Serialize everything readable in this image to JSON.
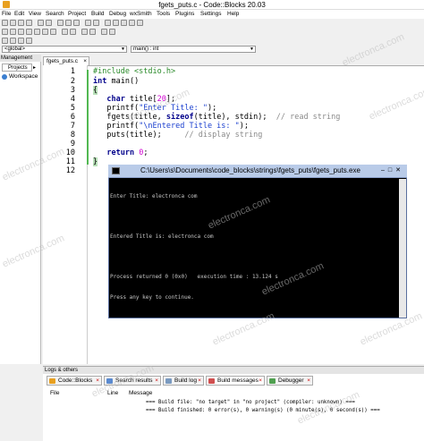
{
  "window": {
    "title": "fgets_puts.c - Code::Blocks 20.03"
  },
  "menu": [
    "File",
    "Edit",
    "View",
    "Search",
    "Project",
    "Build",
    "Debug",
    "wxSmith",
    "Tools",
    "Plugins",
    "Settings",
    "Help"
  ],
  "scope_combo": {
    "value": "<global>"
  },
  "function_combo": {
    "value": "main() : int"
  },
  "management": {
    "header": "Management",
    "tab": "Projects",
    "workspace": "Workspace"
  },
  "editor": {
    "tab_label": "fgets_puts.c",
    "line_numbers": [
      "1",
      "2",
      "3",
      "4",
      "5",
      "6",
      "7",
      "8",
      "9",
      "10",
      "11",
      "12"
    ]
  },
  "console": {
    "title": "C:\\Users\\s\\Documents\\code_blocks\\strings\\fgets_puts\\fgets_puts.exe",
    "lines": [
      "Enter Title: electronca com",
      "",
      "Entered Title is: electronca com",
      "",
      "Process returned 0 (0x0)   execution time : 13.124 s",
      "Press any key to continue."
    ]
  },
  "logs": {
    "header": "Logs & others",
    "tabs": [
      "Code::Blocks",
      "Search results",
      "Build log",
      "Build messages",
      "Debugger"
    ],
    "columns": [
      "File",
      "Line",
      "Message"
    ],
    "messages": [
      "=== Build file: \"no target\" in \"no project\" (compiler: unknown) ===",
      "=== Build finished: 0 error(s), 0 warning(s) (0 minute(s), 0 second(s)) ==="
    ]
  },
  "watermark": "electronca.com"
}
